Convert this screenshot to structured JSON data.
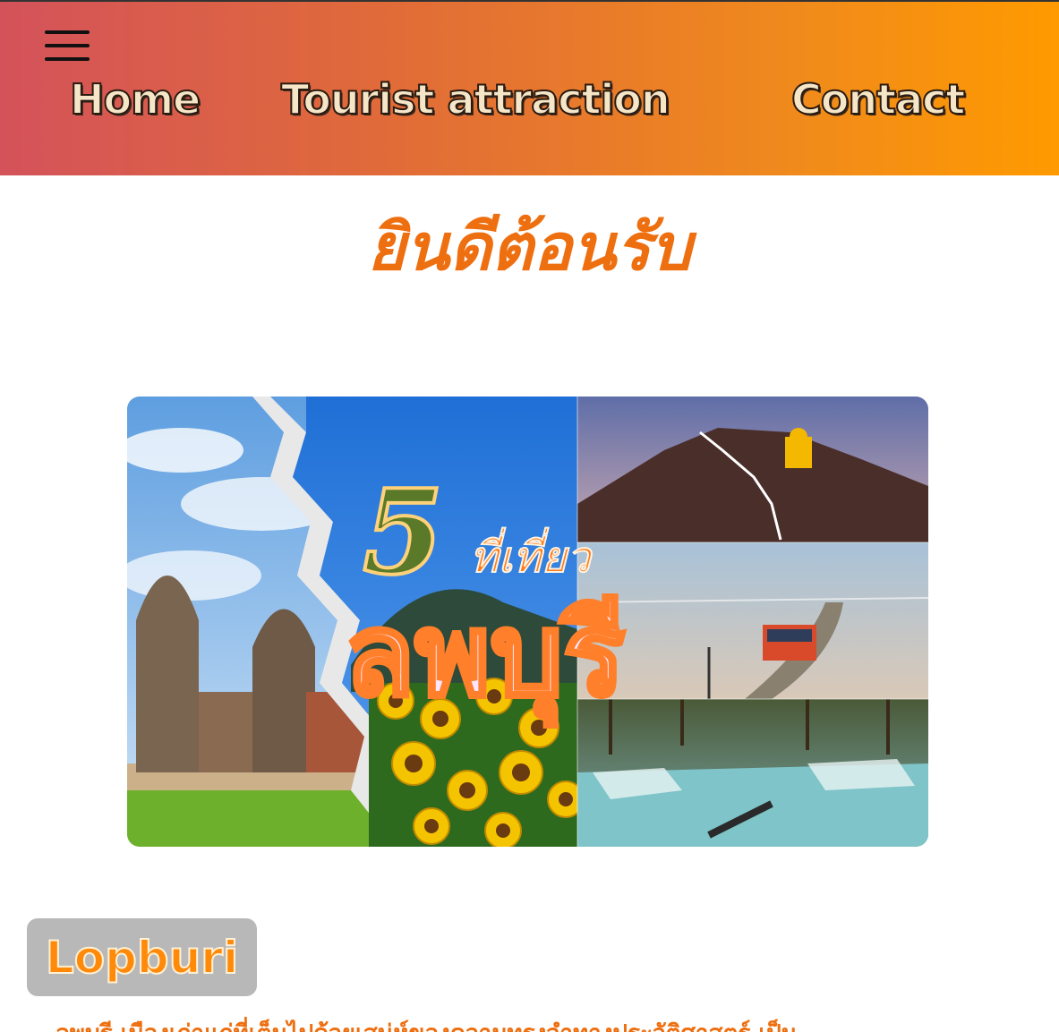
{
  "header": {
    "nav": {
      "home": "Home",
      "attraction": "Tourist attraction",
      "contact": "Contact"
    }
  },
  "main": {
    "welcome": "ยินดีต้อนรับ",
    "hero": {
      "number": "5",
      "subtitle": "ที่เที่ยว",
      "title": "ลพบุรี"
    },
    "badge": "Lopburi",
    "intro_text": "ลพบุรี เมืองเก่าแก่ที่เต็มไปด้วยเสน่ห์ของความทรงจำทางประวัติศาสตร์ เป็น"
  },
  "colors": {
    "header_start": "#d4525a",
    "header_end": "#ff9a00",
    "accent_orange": "#ee6f10",
    "badge_bg": "#b8b8b8"
  },
  "icons": {
    "menu": "hamburger-menu-icon"
  }
}
